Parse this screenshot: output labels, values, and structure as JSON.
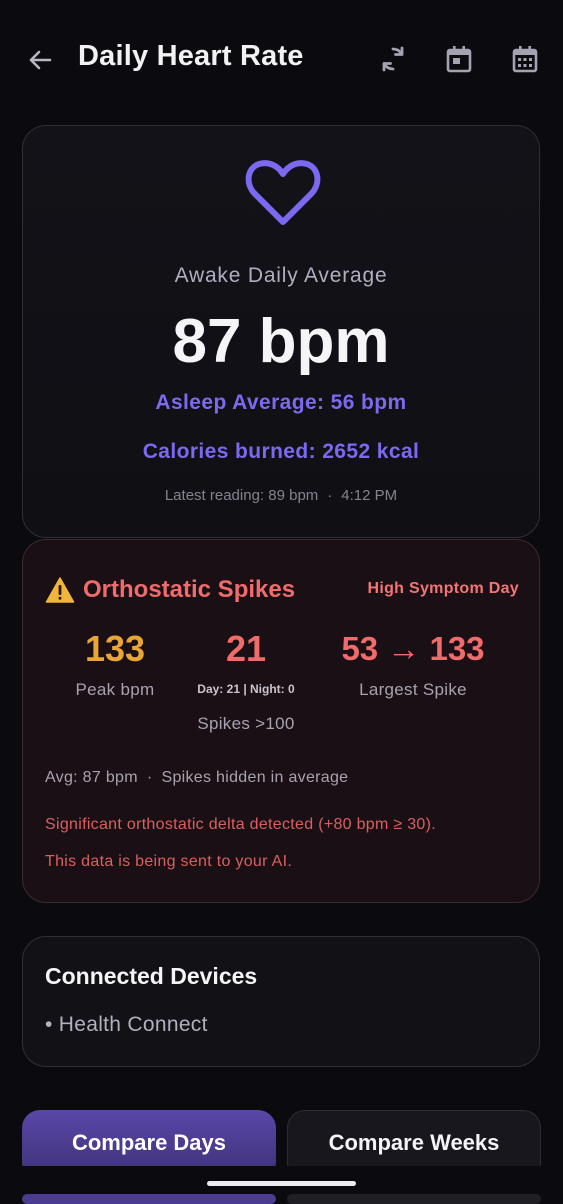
{
  "header": {
    "title": "Daily Heart Rate",
    "icons": [
      "back-arrow-icon",
      "sync-icon",
      "calendar-day-icon",
      "calendar-month-icon"
    ]
  },
  "summary": {
    "icon": "heart-outline-icon",
    "awake_label": "Awake Daily Average",
    "awake_value": "87 bpm",
    "asleep_text": "Asleep Average: 56 bpm",
    "calories_text": "Calories burned: 2652 kcal",
    "latest_reading": "Latest reading: 89 bpm",
    "latest_sep": "·",
    "latest_time": "4:12 PM",
    "accent_color": "#7b6af0"
  },
  "spikes": {
    "title": "Orthostatic Spikes",
    "badge": "High Symptom Day",
    "peak_value": "133",
    "peak_label": "Peak bpm",
    "spikes_value": "21",
    "day_night": "Day: 21 | Night: 0",
    "spikes_label": "Spikes >100",
    "largest_value": "53 → 133",
    "largest_label": "Largest Spike",
    "avg_text": "Avg: 87 bpm",
    "avg_sep": "·",
    "avg_note": "Spikes hidden in average",
    "delta_text": "Significant orthostatic delta detected (+80 bpm ≥ 30).",
    "sent_text": "This data is being sent to your AI.",
    "warning_color": "#f06b6b",
    "peak_color": "#e9a536"
  },
  "devices": {
    "title": "Connected Devices",
    "items": [
      "• Health Connect"
    ]
  },
  "buttons": {
    "compare_days": "Compare Days",
    "compare_weeks": "Compare Weeks"
  }
}
